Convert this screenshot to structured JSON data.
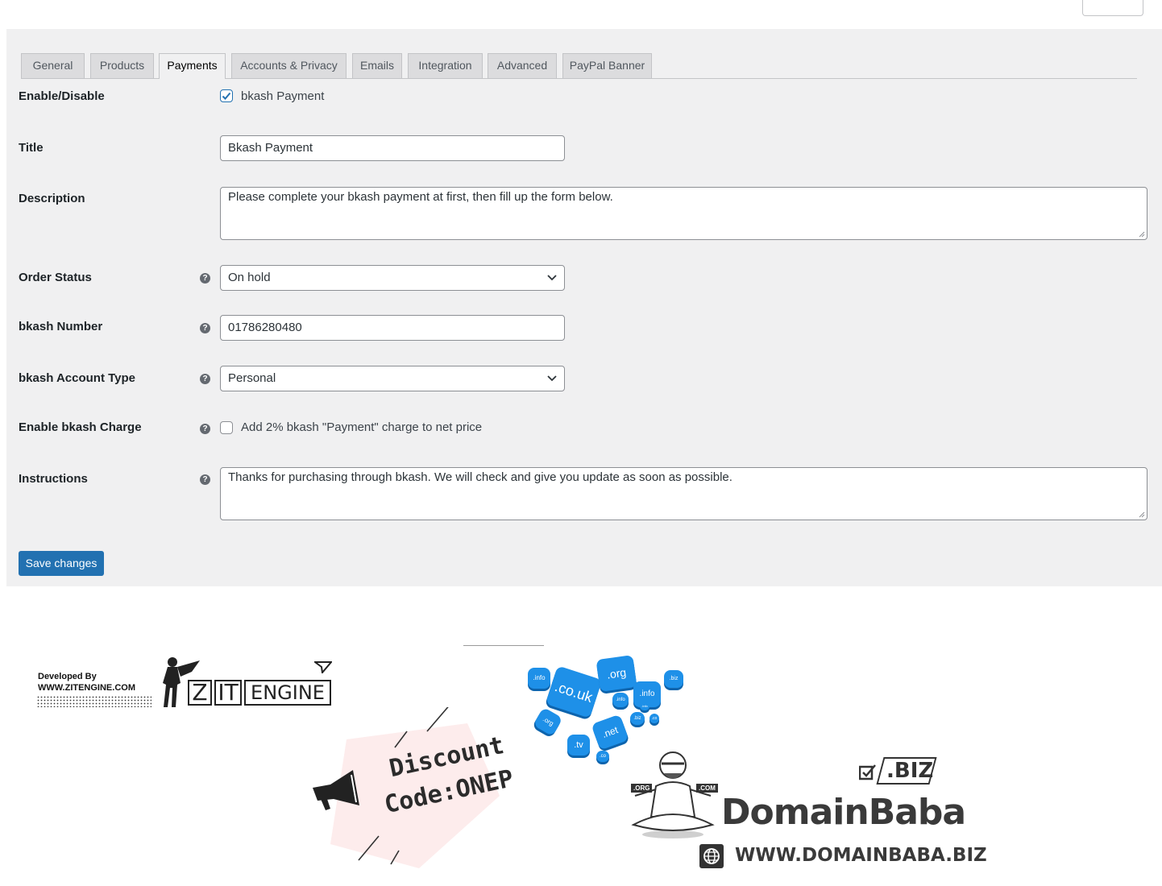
{
  "tabs": [
    {
      "label": "General",
      "active": false
    },
    {
      "label": "Products",
      "active": false
    },
    {
      "label": "Payments",
      "active": true
    },
    {
      "label": "Accounts & Privacy",
      "active": false
    },
    {
      "label": "Emails",
      "active": false
    },
    {
      "label": "Integration",
      "active": false
    },
    {
      "label": "Advanced",
      "active": false
    },
    {
      "label": "PayPal Banner",
      "active": false
    }
  ],
  "form": {
    "enable": {
      "label": "Enable/Disable",
      "checkbox_label": "bkash Payment",
      "checked": true
    },
    "title": {
      "label": "Title",
      "value": "Bkash Payment"
    },
    "description": {
      "label": "Description",
      "value": "Please complete your bkash payment at first, then fill up the form below."
    },
    "order_status": {
      "label": "Order Status",
      "value": "On hold"
    },
    "bkash_number": {
      "label": "bkash Number",
      "value": "01786280480"
    },
    "account_type": {
      "label": "bkash Account Type",
      "value": "Personal"
    },
    "charge": {
      "label": "Enable bkash Charge",
      "checkbox_label": "Add 2% bkash \"Payment\" charge to net price",
      "checked": false
    },
    "instructions": {
      "label": "Instructions",
      "value": "Thanks for purchasing through bkash. We will check and give you update as soon as possible."
    },
    "help_glyph": "?"
  },
  "save_button": "Save changes",
  "promo": {
    "developed_by": "Developed By",
    "dev_url": "WWW.ZITENGINE.COM",
    "zit_letters": [
      "Z",
      "IT",
      "ENGINE"
    ],
    "discount_word": "Discount",
    "discount_code": "Code:ONEP",
    "domain_brand": "DomainBaba",
    "domain_url": "WWW.DOMAINBABA.BIZ",
    "biz_tag": ".BIZ",
    "tld_bubbles": [
      ".org",
      ".co.uk",
      ".info",
      ".biz",
      ".info",
      ".org",
      ".net",
      ".tv",
      ".info",
      ".co",
      ".biz",
      ".co",
      ".info"
    ],
    "figure_tags": [
      ".ORG",
      ".COM"
    ]
  },
  "colors": {
    "accent": "#2271b1",
    "domain_blue": "#1e90e8",
    "admin_bg": "#f0f0f1"
  }
}
